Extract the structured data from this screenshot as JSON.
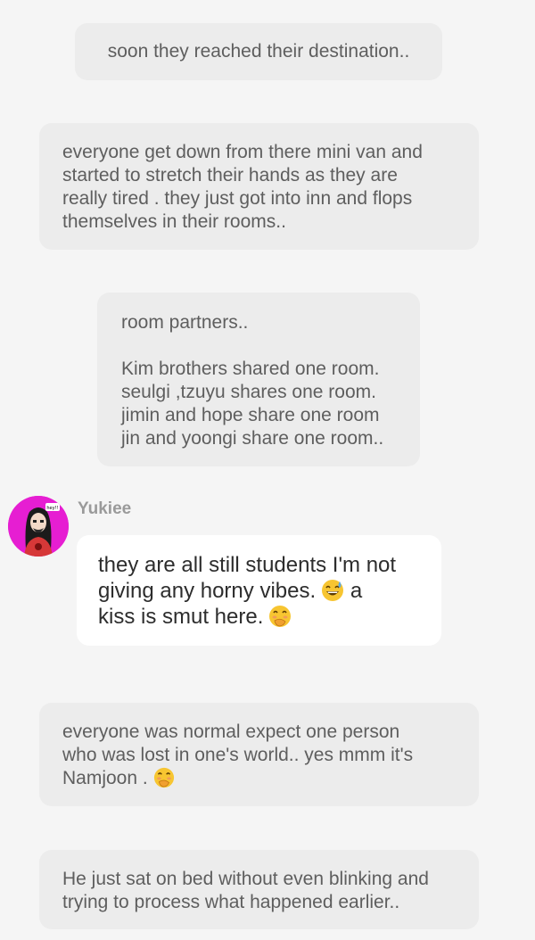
{
  "narrations": [
    {
      "lines": [
        "soon they reached their destination.."
      ]
    },
    {
      "lines": [
        "everyone get down from there mini van and",
        "started to stretch their hands as they are",
        "really tired . they just got into inn and flops",
        "themselves in their rooms.."
      ]
    },
    {
      "title": "room partners..",
      "lines": [
        "Kim brothers shared one room.",
        "seulgi ,tzuyu shares one room.",
        "jimin and hope share one room",
        "jin and yoongi share one room.."
      ]
    },
    {
      "lines": [
        "everyone was normal expect one person",
        "who was lost in one's world.. yes mmm it's",
        "Namjoon ."
      ],
      "trailing_icon": "hand-over-mouth-emoji"
    },
    {
      "lines": [
        "He just sat on bed without even blinking and",
        "trying to process what happened earlier.."
      ]
    }
  ],
  "author_note": {
    "author": "Yukiee",
    "avatar_icon": "avatar-cartoon-girl",
    "avatar_badge": "hey!!",
    "avatar_bg": "#e61ed2",
    "line1": "they are all still students I'm not",
    "line2_text": "giving any horny vibes.",
    "line2_icon": "grinning-sweat-emoji",
    "line2_after": "a",
    "line3_text": "kiss is smut here.",
    "line3_icon": "hand-over-mouth-emoji"
  }
}
